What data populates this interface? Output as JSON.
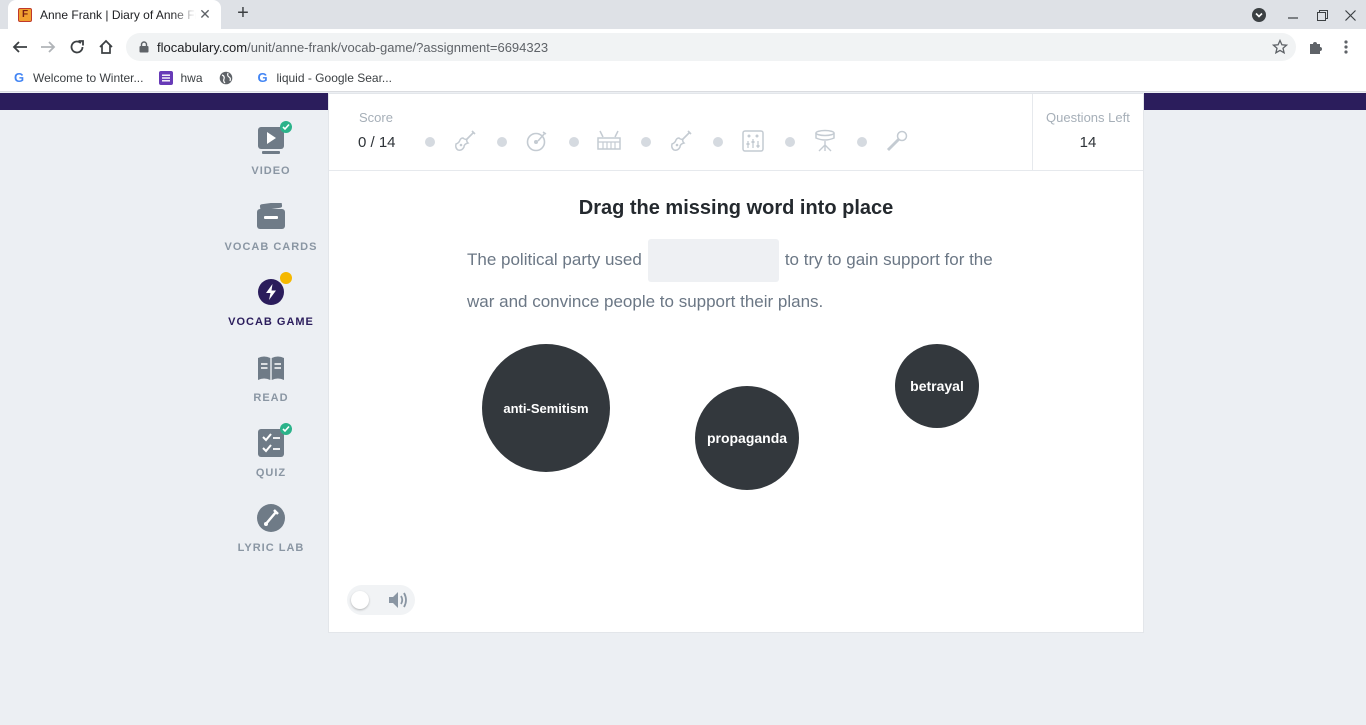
{
  "browser": {
    "tab_title": "Anne Frank | Diary of Anne Frank",
    "tab_favicon": "F",
    "url_domain": "flocabulary.com",
    "url_path": "/unit/anne-frank/vocab-game/?assignment=6694323",
    "bookmarks": [
      {
        "label": "Welcome to Winter...",
        "icon": "google-icon"
      },
      {
        "label": "hwa",
        "icon": "list-icon"
      },
      {
        "label": "",
        "icon": "globe-icon"
      },
      {
        "label": "liquid - Google Sear...",
        "icon": "google-icon"
      }
    ]
  },
  "sidebar": {
    "items": [
      {
        "label": "VIDEO",
        "icon": "video-icon",
        "status": "complete"
      },
      {
        "label": "VOCAB CARDS",
        "icon": "vocab-cards-icon",
        "status": "none"
      },
      {
        "label": "VOCAB GAME",
        "icon": "lightning-icon",
        "status": "in-progress",
        "active": true
      },
      {
        "label": "READ",
        "icon": "book-icon",
        "status": "none"
      },
      {
        "label": "QUIZ",
        "icon": "quiz-icon",
        "status": "complete"
      },
      {
        "label": "LYRIC LAB",
        "icon": "lyric-lab-icon",
        "status": "none"
      }
    ]
  },
  "game": {
    "score_label": "Score",
    "score_value": "0 / 14",
    "questions_left_label": "Questions Left",
    "questions_left_value": "14",
    "progress_icons": [
      "guitar-icon",
      "record-icon",
      "keyboard-icon",
      "guitar-icon",
      "mixer-icon",
      "drum-icon",
      "microphone-icon"
    ],
    "instruction": "Drag the missing word into place",
    "sentence_before": "The political party used",
    "sentence_after": "to try to gain support for the war and convince people to support their plans.",
    "word_choices": [
      "anti-Semitism",
      "propaganda",
      "betrayal"
    ],
    "sound_enabled": false
  },
  "colors": {
    "brand_purple": "#2b1d5c",
    "bubble": "#33383d",
    "complete_badge": "#2bb38a",
    "in_progress_badge": "#f5b800"
  }
}
